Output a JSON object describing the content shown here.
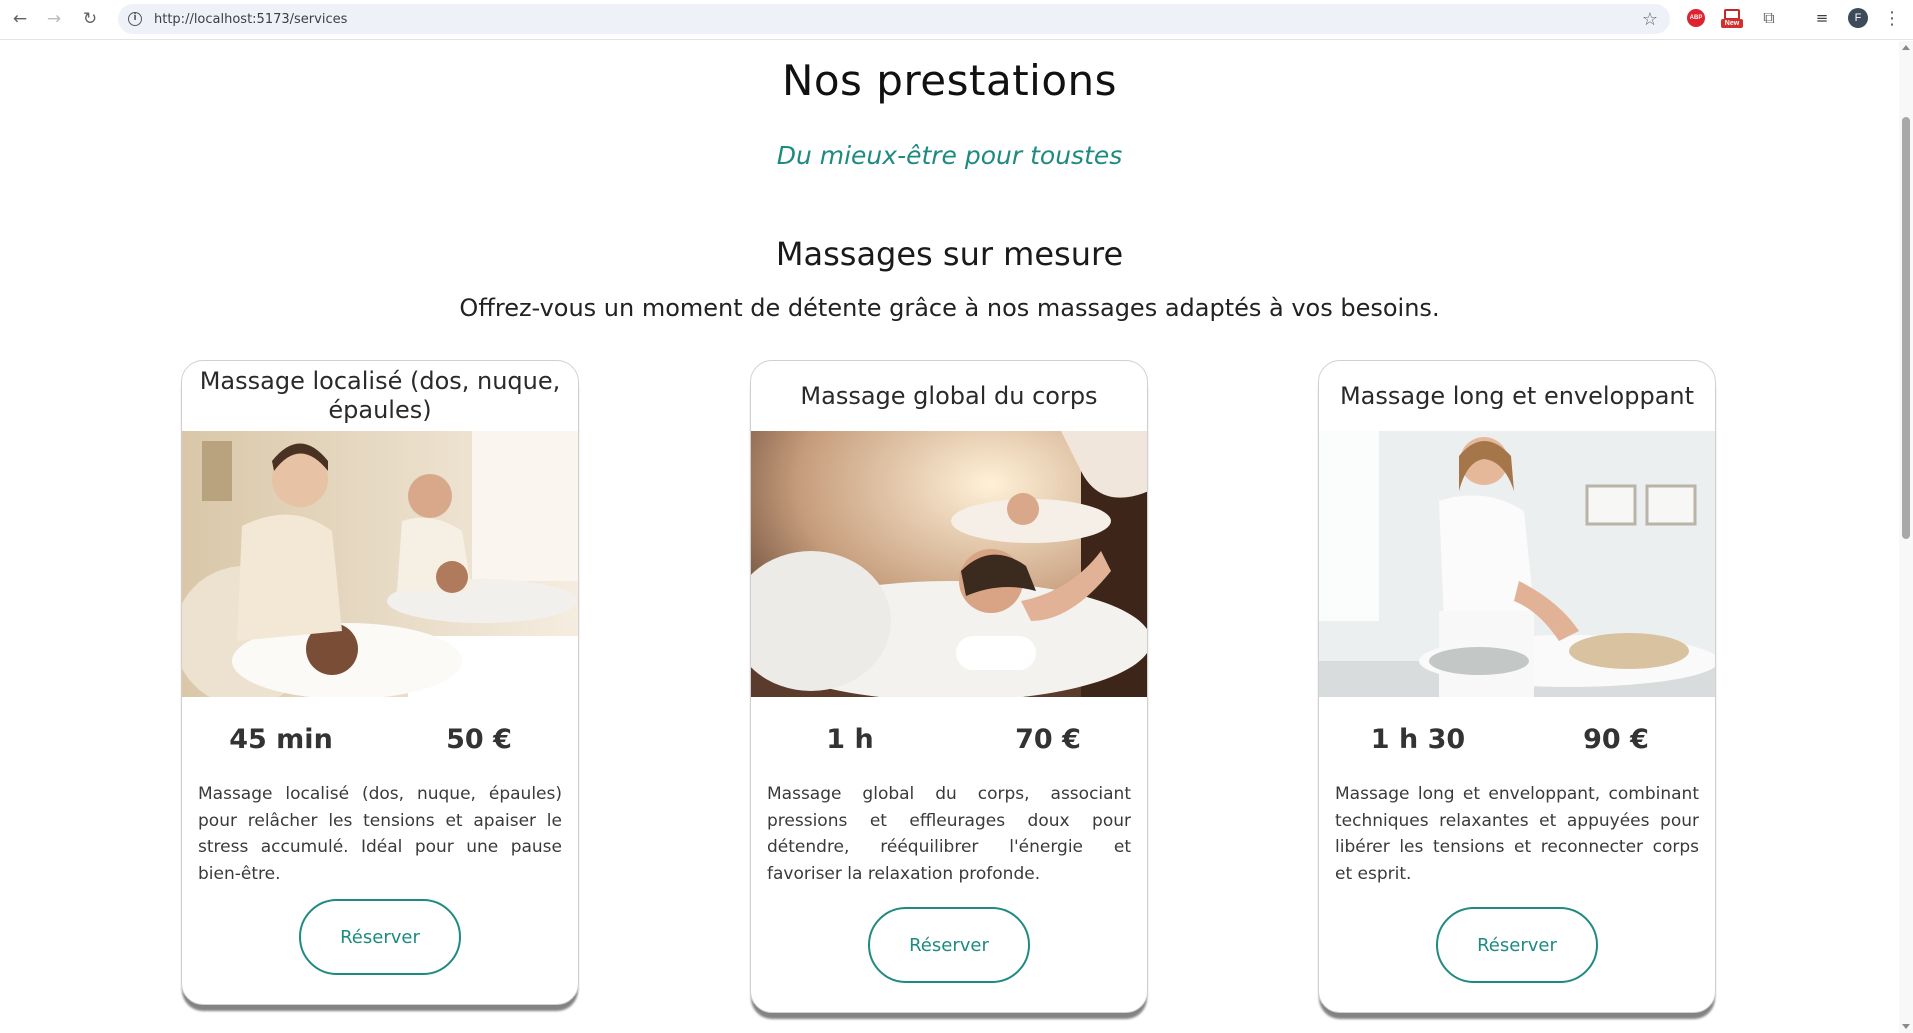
{
  "browser": {
    "url": "http://localhost:5173/services",
    "avatar_letter": "F",
    "abp_label": "ABP",
    "new_label": "New"
  },
  "page": {
    "title": "Nos prestations",
    "subtitle": "Du mieux-être pour toustes",
    "section_title": "Massages sur mesure",
    "section_description": "Offrez-vous un moment de détente grâce à nos massages adaptés à vos besoins."
  },
  "cards": [
    {
      "title": "Massage localisé (dos, nuque, épaules)",
      "duration": "45 min",
      "price": "50 €",
      "description": "Massage localisé (dos, nuque, épaules) pour relâcher les tensions et apaiser le stress accumulé. Idéal pour une pause bien-être.",
      "button_label": "Réserver"
    },
    {
      "title": "Massage global du corps",
      "duration": "1 h",
      "price": "70 €",
      "description": "Massage global du corps, associant pressions et effleurages doux pour détendre, rééquilibrer l'énergie et favoriser la relaxation profonde.",
      "button_label": "Réserver"
    },
    {
      "title": "Massage long et enveloppant",
      "duration": "1 h 30",
      "price": "90 €",
      "description": "Massage long et enveloppant, combinant techniques relaxantes et appuyées pour libérer les tensions et reconnecter corps et esprit.",
      "button_label": "Réserver"
    }
  ],
  "colors": {
    "accent": "#1e8a80",
    "card_border": "#d0d0d0"
  }
}
